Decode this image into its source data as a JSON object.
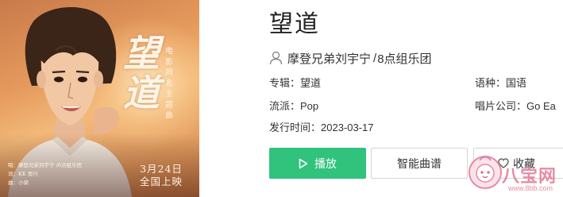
{
  "cover": {
    "title_chars": [
      "望",
      "道"
    ],
    "vertical_subtitle": "电影同名主题曲",
    "credits": [
      "唱：摩登兄弟刘宇宁 /8点组乐团",
      "词：KK 贾行",
      "曲：小梁"
    ],
    "release_date_line1": "3月24日",
    "release_date_line2": "全国上映"
  },
  "song": {
    "title": "望道",
    "artist_primary": "摩登兄弟刘宇宁",
    "artist_separator": "/",
    "artist_secondary": "8点组乐团"
  },
  "meta": {
    "album_label": "专辑：",
    "album_value": "望道",
    "genre_label": "流派：",
    "genre_value": "Pop",
    "release_label": "发行时间：",
    "release_value": "2023-03-17",
    "language_label": "语种：",
    "language_value": "国语",
    "record_label_label": "唱片公司：",
    "record_label_value": "Go Ea"
  },
  "buttons": {
    "play": "播放",
    "score": "智能曲谱",
    "favorite": "收藏"
  },
  "watermark": {
    "text": "八宝网",
    "url": "www.8bb.com"
  },
  "colors": {
    "accent_green": "#31c27c",
    "watermark_pink": "#e27896"
  },
  "icons": {
    "artist": "user-icon",
    "play": "play-icon",
    "favorite": "heart-icon"
  }
}
